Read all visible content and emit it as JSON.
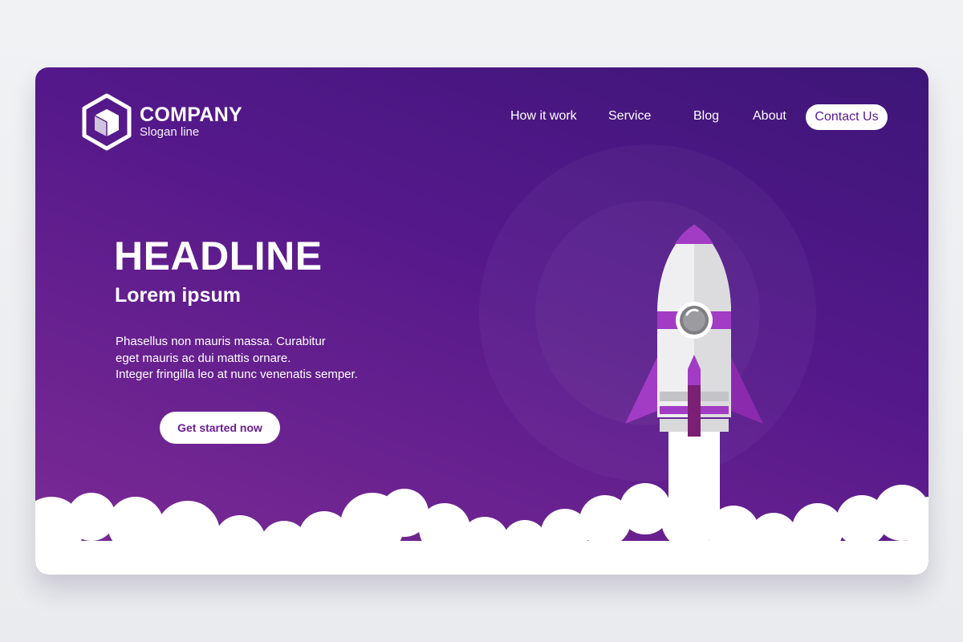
{
  "brand": {
    "name": "COMPANY",
    "slogan": "Slogan line",
    "logo_icon": "hexagon-cube-icon"
  },
  "nav": {
    "items": [
      "How it work",
      "Service",
      "Blog",
      "About"
    ],
    "contact_label": "Contact Us"
  },
  "hero": {
    "headline": "HEADLINE",
    "subheadline": "Lorem ipsum",
    "body_lines": [
      "Phasellus non mauris massa.  Curabitur",
      "eget mauris ac dui mattis ornare.",
      "Integer fringilla leo at nunc venenatis semper."
    ],
    "cta_label": "Get started now",
    "illustration": "rocket-icon"
  },
  "colors": {
    "background_top": "#3d1678",
    "background_bottom": "#7d2b95",
    "accent": "#a23cc4",
    "button_text": "#5a1a8c",
    "cloud": "#ffffff"
  }
}
